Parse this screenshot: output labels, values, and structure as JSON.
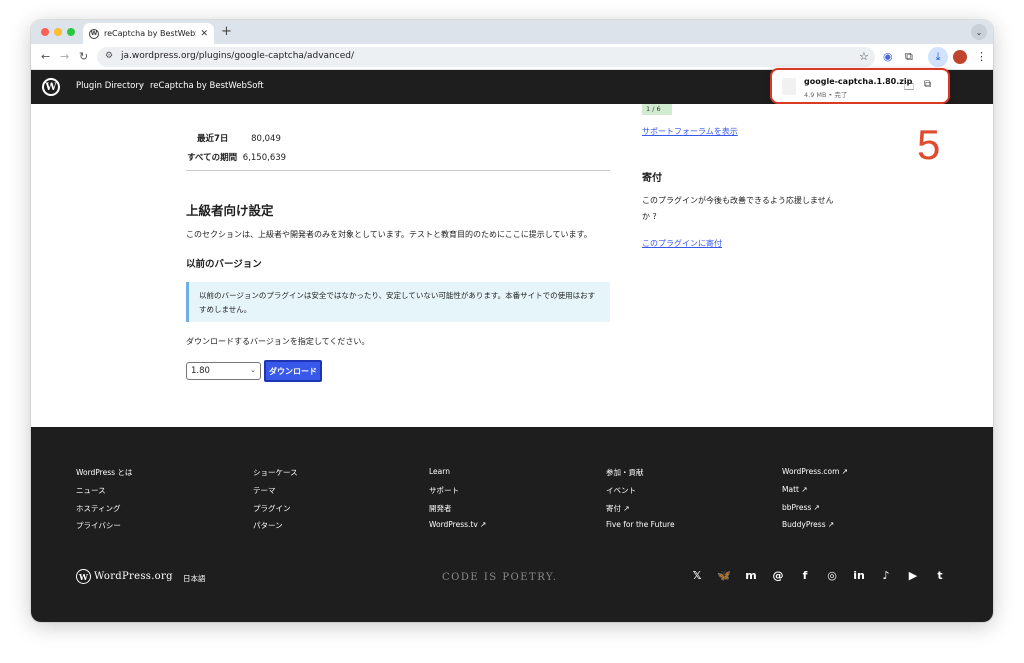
{
  "browser": {
    "tab_title": "reCaptcha by BestWebSoft (...",
    "tab_close": "✕",
    "new_tab": "+",
    "url": "ja.wordpress.org/plugins/google-captcha/advanced/"
  },
  "download": {
    "filename": "google-captcha.1.80.zip",
    "status": "4.9 MB • 完了"
  },
  "header": {
    "nav1": "Plugin Directory",
    "separator": "•",
    "nav2": "reCaptcha by BestWebSoft"
  },
  "stats": {
    "last7_label": "最近7日",
    "last7_value": "80,049",
    "all_label": "すべての期間",
    "all_value": "6,150,639"
  },
  "advanced": {
    "title": "上級者向け設定",
    "description": "このセクションは、上級者や開発者のみを対象としています。テストと教育目的のためにここに提示しています。",
    "prev_title": "以前のバージョン",
    "notice": "以前のバージョンのプラグインは安全ではなかったり、安定していない可能性があります。本番サイトでの使用はおすすめしません。",
    "specify": "ダウンロードするバージョンを指定してください。",
    "selected_version": "1.80",
    "download_label": "ダウンロード"
  },
  "sidebar": {
    "badge": "1 / 6",
    "support_link": "サポートフォーラムを表示",
    "donate_title": "寄付",
    "donate_text": "このプラグインが今後も改善できるよう応援しませんか ?",
    "donate_link": "このプラグインに寄付"
  },
  "annotation": {
    "step": "5"
  },
  "footer": {
    "col1": [
      "WordPress とは",
      "ニュース",
      "ホスティング",
      "プライバシー"
    ],
    "col2": [
      "ショーケース",
      "テーマ",
      "プラグイン",
      "パターン"
    ],
    "col3": [
      "Learn",
      "サポート",
      "開発者",
      "WordPress.tv ↗"
    ],
    "col4": [
      "参加・貢献",
      "イベント",
      "寄付 ↗",
      "Five for the Future"
    ],
    "col5": [
      "WordPress.com ↗",
      "Matt ↗",
      "bbPress ↗",
      "BuddyPress ↗"
    ],
    "wordmark": "WordPress.org",
    "language": "日本語",
    "tagline": "CODE IS POETRY.",
    "social_icons": [
      "x-icon",
      "bluesky-icon",
      "mastodon-icon",
      "threads-icon",
      "facebook-icon",
      "instagram-icon",
      "linkedin-icon",
      "tiktok-icon",
      "youtube-icon",
      "tumblr-icon"
    ]
  },
  "colors": {
    "accent": "#3858e9",
    "header_bg": "#1e1e1e",
    "annotation": "#e04a2f"
  }
}
